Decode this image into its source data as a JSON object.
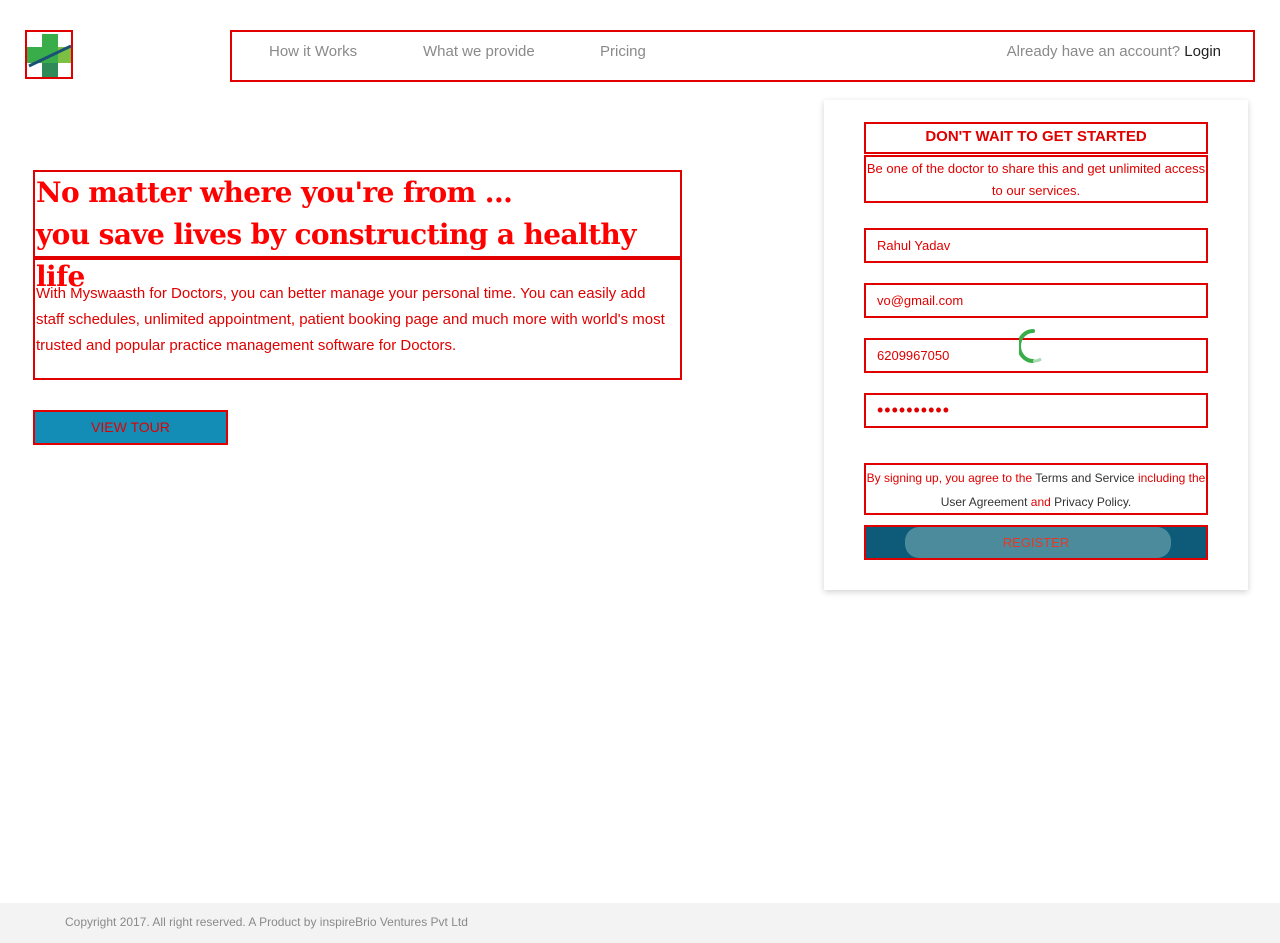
{
  "brand": {
    "logo_icon": "medical-cross-icon",
    "colors": {
      "accent": "#e00000",
      "primary": "#138db6",
      "dark": "#0d5b78",
      "logo_green": "#3aad4b"
    }
  },
  "nav": {
    "links": [
      "How it Works",
      "What we provide",
      "Pricing"
    ],
    "account_prompt": "Already have an account?",
    "login_label": "Login"
  },
  "hero": {
    "line1": "No matter where you're from ...",
    "line2": "you save lives by constructing a healthy life",
    "description": "With Myswaasth for Doctors, you can better manage your personal time. You can easily add staff schedules, unlimited appointment, patient booking page and much more with world's most trusted and popular practice management software for Doctors.",
    "view_tour_label": "VIEW TOUR"
  },
  "signup": {
    "title": "DON'T WAIT TO GET STARTED",
    "subtitle": "Be one of the doctor to share this and get unlimited access to our services.",
    "name_value": "Rahul Yadav",
    "email_value": "vo@gmail.com",
    "phone_value": "6209967050",
    "password_value": "••••••••••",
    "terms": {
      "part1": "By signing up, you agree to the ",
      "link1": "Terms and Service",
      "part2": " including the ",
      "link2": "User Agreement",
      "part3": " and ",
      "link3": "Privacy Policy.",
      "part4": ""
    },
    "register_label": "REGISTER",
    "spinner_icon": "loading-spinner-icon"
  },
  "footer": {
    "copyright": "Copyright 2017. All right reserved. A Product by inspireBrio Ventures Pvt Ltd"
  }
}
